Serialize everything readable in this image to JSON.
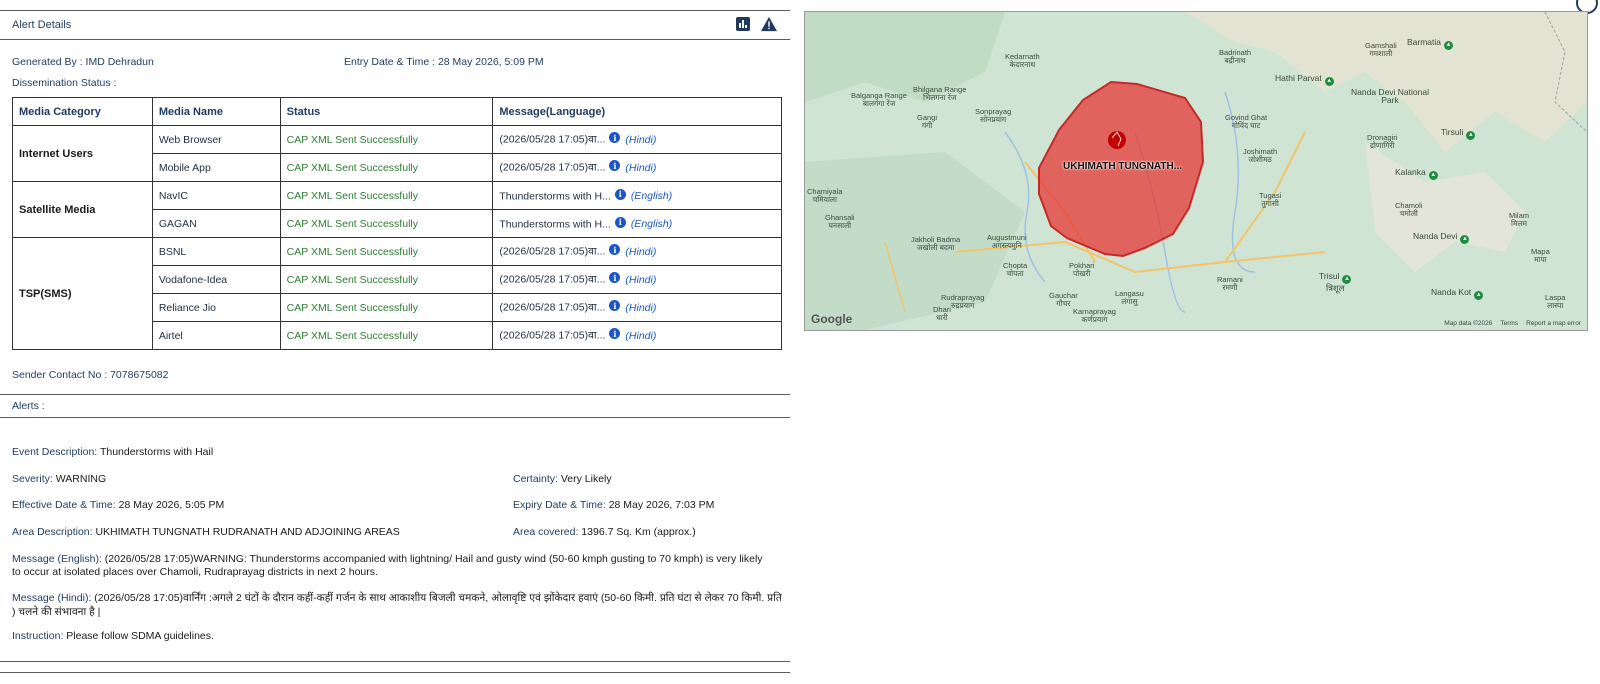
{
  "panel": {
    "title": "Alert Details",
    "chart_icon": "bar-chart-icon",
    "warning_icon": "warning-triangle-icon"
  },
  "meta": {
    "generated_by_label": "Generated By :",
    "generated_by": "IMD Dehradun",
    "entry_label": "Entry Date & Time :",
    "entry_value": "28 May 2026, 5:09 PM",
    "dissemination_label": "Dissemination Status :"
  },
  "table": {
    "headers": [
      "Media Category",
      "Media Name",
      "Status",
      "Message(Language)"
    ],
    "groups": [
      {
        "category": "Internet Users",
        "rows": [
          {
            "name": "Web Browser",
            "status": "CAP XML Sent Successfully",
            "message": "(2026/05/28 17:05)वा...",
            "language": "(Hindi)"
          },
          {
            "name": "Mobile App",
            "status": "CAP XML Sent Successfully",
            "message": "(2026/05/28 17:05)वा...",
            "language": "(Hindi)"
          }
        ]
      },
      {
        "category": "Satellite Media",
        "rows": [
          {
            "name": "NavIC",
            "status": "CAP XML Sent Successfully",
            "message": "Thunderstorms with H...",
            "language": "(English)"
          },
          {
            "name": "GAGAN",
            "status": "CAP XML Sent Successfully",
            "message": "Thunderstorms with H...",
            "language": "(English)"
          }
        ]
      },
      {
        "category": "TSP(SMS)",
        "rows": [
          {
            "name": "BSNL",
            "status": "CAP XML Sent Successfully",
            "message": "(2026/05/28 17:05)वा...",
            "language": "(Hindi)"
          },
          {
            "name": "Vodafone-Idea",
            "status": "CAP XML Sent Successfully",
            "message": "(2026/05/28 17:05)वा...",
            "language": "(Hindi)"
          },
          {
            "name": "Reliance Jio",
            "status": "CAP XML Sent Successfully",
            "message": "(2026/05/28 17:05)वा...",
            "language": "(Hindi)"
          },
          {
            "name": "Airtel",
            "status": "CAP XML Sent Successfully",
            "message": "(2026/05/28 17:05)वा...",
            "language": "(Hindi)"
          }
        ]
      }
    ]
  },
  "sender": {
    "label": "Sender Contact No :",
    "value": "7078675082"
  },
  "alerts": {
    "label": "Alerts :",
    "event_label": "Event Description:",
    "event_value": "Thunderstorms with Hail",
    "severity_label": "Severity:",
    "severity_value": "WARNING",
    "certainty_label": "Certainty:",
    "certainty_value": "Very Likely",
    "effective_label": "Effective Date & Time:",
    "effective_value": "28 May 2026, 5:05 PM",
    "expiry_label": "Expiry Date & Time:",
    "expiry_value": "28 May 2026, 7:03 PM",
    "area_label": "Area Description:",
    "area_value": "UKHIMATH TUNGNATH RUDRANATH AND ADJOINING AREAS",
    "covered_label": "Area covered:",
    "covered_value": "1396.7 Sq. Km (approx.)",
    "msg_en_label": "Message (English):",
    "msg_en_value": "(2026/05/28 17:05)WARNING: Thunderstorms accompanied with lightning/ Hail and gusty wind (50-60 kmph gusting to 70 kmph) is very likely to occur at isolated places over Chamoli, Rudraprayag districts in next 2 hours.",
    "msg_hi_label": "Message (Hindi):",
    "msg_hi_value": "(2026/05/28 17:05)वार्निंग :अगले 2 घंटों के दौरान कहीं-कहीं गर्जन के साथ आकाशीय बिजली चमकने, ओलावृष्टि एवं झोंकेदार हवाएं (50-60 किमी. प्रति घंटा से लेकर 70 किमी. प्रति ) चलने की संभावना है |",
    "instruction_label": "Instruction:",
    "instruction_value": "Please follow SDMA guidelines."
  },
  "map": {
    "polygon_label": "UKHIMATH TUNGNATH...",
    "google": "Google",
    "attribution": [
      "Map data ©2026",
      "Terms",
      "Report a map error"
    ],
    "polygon_color": "#e53935",
    "places": [
      {
        "name": "Kedarnath",
        "sub": "केदारनाथ"
      },
      {
        "name": "Badrinath",
        "sub": "बद्रीनाथ"
      },
      {
        "name": "Hathi Parvat",
        "sub": ""
      },
      {
        "name": "Gamshali",
        "sub": "गमशाली"
      },
      {
        "name": "Barmatia",
        "sub": ""
      },
      {
        "name": "Nanda Devi National Park",
        "sub": ""
      },
      {
        "name": "Bhilgana Range",
        "sub": "भिलगना रेंज"
      },
      {
        "name": "Balganga Range",
        "sub": "बालगंगा रेंज"
      },
      {
        "name": "Sonprayag",
        "sub": "सोनप्रयाग"
      },
      {
        "name": "Gangi",
        "sub": "गंगी"
      },
      {
        "name": "Govind Ghat",
        "sub": "गोविंद घाट"
      },
      {
        "name": "Joshimath",
        "sub": "जोशीमठ"
      },
      {
        "name": "Dronagiri",
        "sub": "द्रोणागिरी"
      },
      {
        "name": "Tirsuli",
        "sub": ""
      },
      {
        "name": "Kalanka",
        "sub": ""
      },
      {
        "name": "Chamiyala",
        "sub": "चमियाला"
      },
      {
        "name": "Ghansali",
        "sub": "घनसाली"
      },
      {
        "name": "Tugasi",
        "sub": "तुगासी"
      },
      {
        "name": "Chamoli",
        "sub": "चमोली"
      },
      {
        "name": "Nanda Devi",
        "sub": ""
      },
      {
        "name": "Milam",
        "sub": "मिलम"
      },
      {
        "name": "Jakholi Badma",
        "sub": "जखोली बदमा"
      },
      {
        "name": "Augustmuni",
        "sub": "अगस्त्यमुनि"
      },
      {
        "name": "Chopta",
        "sub": "चोपता"
      },
      {
        "name": "Pokhari",
        "sub": "पोखरी"
      },
      {
        "name": "Ramani",
        "sub": "रमणी"
      },
      {
        "name": "Trisul",
        "sub": "त्रिशूल"
      },
      {
        "name": "Mapa",
        "sub": "मापा"
      },
      {
        "name": "Rudraprayag",
        "sub": "रुद्रप्रयाग"
      },
      {
        "name": "Gauchar",
        "sub": "गौचर"
      },
      {
        "name": "Langasu",
        "sub": "लंगासु"
      },
      {
        "name": "Karnaprayag",
        "sub": "कर्णप्रयाग"
      },
      {
        "name": "Dhari",
        "sub": "धारी"
      },
      {
        "name": "Nanda Kot",
        "sub": ""
      },
      {
        "name": "Laspa",
        "sub": "लास्पा"
      }
    ]
  }
}
